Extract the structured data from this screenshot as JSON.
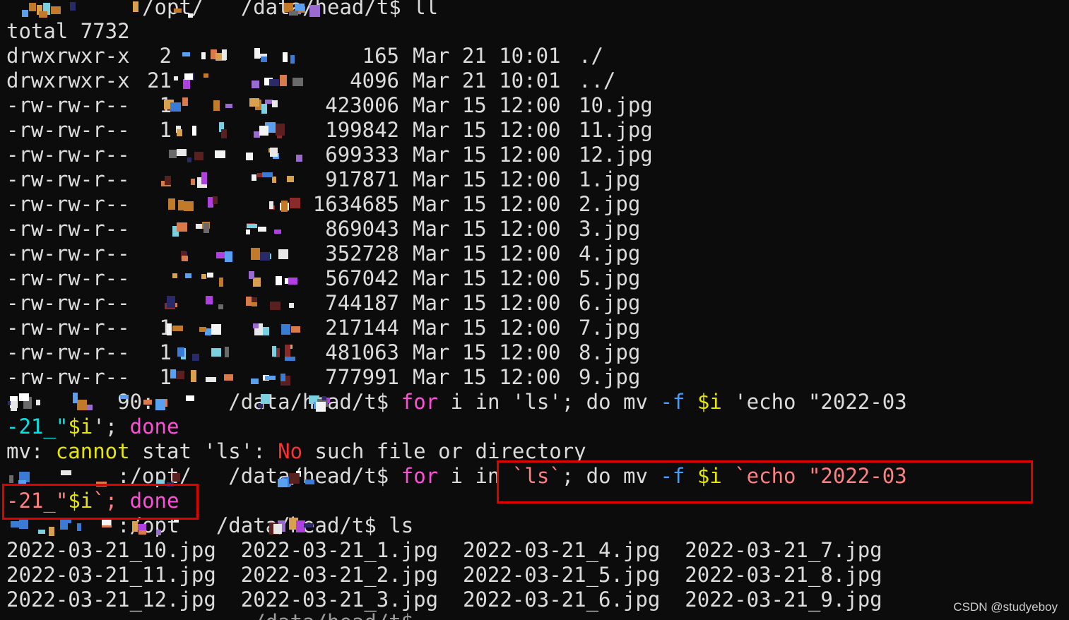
{
  "terminal": {
    "prompt_path": "/data/head/t$",
    "cmd1": {
      "prompt_tail": "/opt/",
      "command": "ll"
    },
    "listing": {
      "total": "total 7732",
      "entries": [
        {
          "perms": "drwxrwxr-x",
          "links": "2",
          "size": "165",
          "date": "Mar 21 10:01",
          "name": "./"
        },
        {
          "perms": "drwxrwxr-x",
          "links": "21",
          "size": "4096",
          "date": "Mar 21 10:01",
          "name": "../"
        },
        {
          "perms": "-rw-rw-r--",
          "links": "1",
          "size": "423006",
          "date": "Mar 15 12:00",
          "name": "10.jpg"
        },
        {
          "perms": "-rw-rw-r--",
          "links": "1",
          "size": "199842",
          "date": "Mar 15 12:00",
          "name": "11.jpg"
        },
        {
          "perms": "-rw-rw-r--",
          "links": "",
          "size": "699333",
          "date": "Mar 15 12:00",
          "name": "12.jpg"
        },
        {
          "perms": "-rw-rw-r--",
          "links": "",
          "size": "917871",
          "date": "Mar 15 12:00",
          "name": "1.jpg"
        },
        {
          "perms": "-rw-rw-r--",
          "links": "",
          "size": "1634685",
          "date": "Mar 15 12:00",
          "name": "2.jpg"
        },
        {
          "perms": "-rw-rw-r--",
          "links": "",
          "size": "869043",
          "date": "Mar 15 12:00",
          "name": "3.jpg"
        },
        {
          "perms": "-rw-rw-r--",
          "links": "",
          "size": "352728",
          "date": "Mar 15 12:00",
          "name": "4.jpg"
        },
        {
          "perms": "-rw-rw-r--",
          "links": "",
          "size": "567042",
          "date": "Mar 15 12:00",
          "name": "5.jpg"
        },
        {
          "perms": "-rw-rw-r--",
          "links": "",
          "size": "744187",
          "date": "Mar 15 12:00",
          "name": "6.jpg"
        },
        {
          "perms": "-rw-rw-r--",
          "links": "1",
          "size": "217144",
          "date": "Mar 15 12:00",
          "name": "7.jpg"
        },
        {
          "perms": "-rw-rw-r--",
          "links": "1",
          "size": "481063",
          "date": "Mar 15 12:00",
          "name": "8.jpg"
        },
        {
          "perms": "-rw-rw-r--",
          "links": "1",
          "size": "777991",
          "date": "Mar 15 12:00",
          "name": "9.jpg"
        }
      ]
    },
    "cmd2": {
      "prompt_tail": "90:",
      "parts": {
        "for": "for",
        "i_in": " i in ",
        "ls_quoted": "'ls'",
        "do_mv": "; do mv ",
        "flag": "-f",
        "sp": " ",
        "var": "$i",
        "echo_quoted": " 'echo \"2022-03"
      },
      "cont": {
        "p1": "-21_\"",
        "var": "$i",
        "p2": "'; ",
        "done": "done"
      }
    },
    "error": {
      "p1": "mv: ",
      "cannot": "cannot",
      "p2": " stat 'ls': ",
      "no": "No",
      "p3": " such file or directory"
    },
    "cmd3": {
      "prompt_tail": ":/opt/",
      "parts": {
        "for": "for",
        "i_in": " i in ",
        "ls_bt": "`ls`",
        "do_mv": "; do mv ",
        "flag": "-f",
        "sp": " ",
        "var": "$i",
        "echo_bt": " `echo \"2022-03"
      },
      "cont": {
        "p1": "-21_\"",
        "var": "$i",
        "p2": "`; ",
        "done": "done"
      }
    },
    "cmd4": {
      "prompt_tail": ":/opt",
      "command": "ls"
    },
    "result_rows": [
      "2022-03-21_10.jpg  2022-03-21_1.jpg  2022-03-21_4.jpg  2022-03-21_7.jpg",
      "2022-03-21_11.jpg  2022-03-21_2.jpg  2022-03-21_5.jpg  2022-03-21_8.jpg",
      "2022-03-21_12.jpg  2022-03-21_3.jpg  2022-03-21_6.jpg  2022-03-21_9.jpg"
    ],
    "last_prompt": "/data/head/t$"
  },
  "watermark": "CSDN @studyeboy",
  "colors": {
    "background": "#0c0c0c",
    "text": "#dcdcdc",
    "keyword": "#ff4fd8",
    "variable": "#e6e600",
    "flag": "#3fa0ff",
    "string": "#ff8080",
    "error": "#ff3030",
    "highlight_box": "#e00000"
  }
}
